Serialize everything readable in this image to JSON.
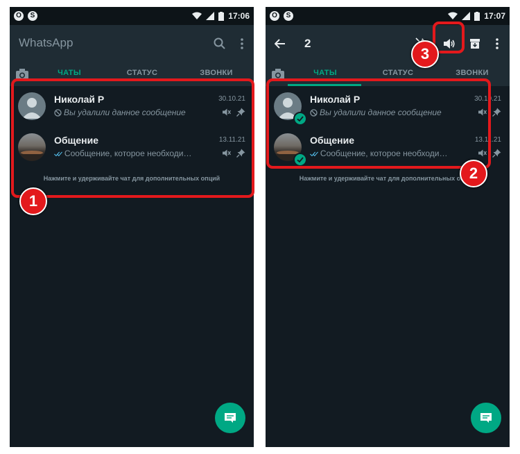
{
  "left_screen": {
    "status_time": "17:06",
    "app_title": "WhatsApp",
    "tabs": [
      "ЧАТЫ",
      "СТАТУС",
      "ЗВОНКИ"
    ],
    "chats": [
      {
        "name": "Николай Р",
        "date": "30.10.21",
        "message": "Вы удалили данное сообщение",
        "message_icon": "deleted-icon"
      },
      {
        "name": "Общение",
        "date": "13.11.21",
        "message": "Сообщение, которое необходимо зак...",
        "message_icon": "double-check-icon"
      }
    ],
    "hint": "Нажмите и удерживайте чат для дополнительных опций"
  },
  "right_screen": {
    "status_time": "17:07",
    "selected_count": "2",
    "tabs": [
      "ЧАТЫ",
      "СТАТУС",
      "ЗВОНКИ"
    ],
    "chats": [
      {
        "name": "Николай Р",
        "date": "30.10.21",
        "message": "Вы удалили данное сообщение",
        "message_icon": "deleted-icon"
      },
      {
        "name": "Общение",
        "date": "13.11.21",
        "message": "Сообщение, которое необходимо зак...",
        "message_icon": "double-check-icon"
      }
    ],
    "hint": "Нажмите и удерживайте чат для дополнительных опций"
  },
  "annotations": {
    "step1": "1",
    "step2": "2",
    "step3": "3"
  },
  "colors": {
    "accent": "#00a884",
    "highlight": "#e3191c",
    "background": "#121b22",
    "appbar": "#1f2c34"
  }
}
